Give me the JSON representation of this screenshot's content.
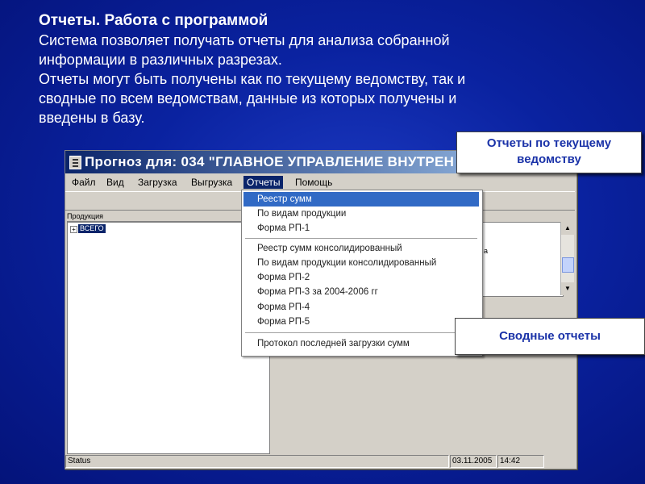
{
  "slide": {
    "title": "Отчеты. Работа с программой",
    "paragraph1_line1": "Система позволяет получать отчеты для анализа собранной",
    "paragraph1_line2": "информации в различных разрезах.",
    "paragraph2_line1": "Отчеты могут быть получены как по текущему ведомству, так и",
    "paragraph2_line2": "сводные по всем ведомствам, данные из которых получены и",
    "paragraph2_line3": "введены в базу."
  },
  "window": {
    "title": "Прогноз для: 034 \"ГЛАВНОЕ УПРАВЛЕНИЕ ВНУТРЕН",
    "icon": "app-icon"
  },
  "menu": {
    "items": [
      "Файл",
      "Вид",
      "Загрузка",
      "Выгрузка",
      "Отчеты",
      "Помощь"
    ],
    "active": "Отчеты"
  },
  "tree": {
    "header": "Продукция",
    "expander": "+",
    "node": "ВСЕГО"
  },
  "right_pane": {
    "fragment": "а"
  },
  "dropdown": {
    "group1": [
      "Реестр сумм",
      "По видам продукции",
      "Форма РП-1"
    ],
    "group2": [
      "Реестр сумм консолидированный",
      "По видам продукции консолидированный",
      "Форма РП-2",
      "Форма РП-3 за 2004-2006 гг",
      "Форма РП-4",
      "Форма РП-5"
    ],
    "group3": [
      "Протокол последней загрузки сумм"
    ],
    "selected": "Реестр сумм"
  },
  "status": {
    "text": "Status",
    "date": "03.11.2005",
    "time": "14:42"
  },
  "callouts": {
    "current_line1": "Отчеты по текущему",
    "current_line2": "ведомству",
    "summary": "Сводные отчеты"
  },
  "scroll": {
    "up_icon": "up-arrow-icon",
    "down_icon": "down-arrow-icon"
  }
}
